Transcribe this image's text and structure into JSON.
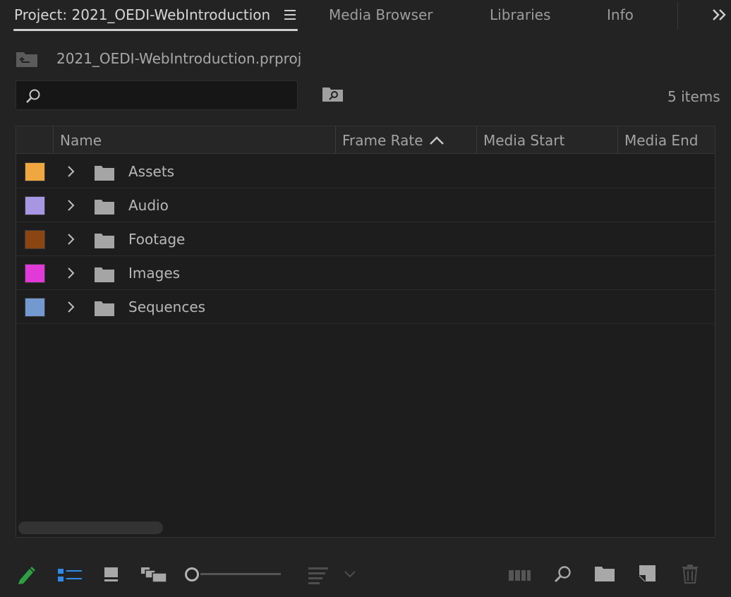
{
  "tabs": [
    {
      "label": "Project: 2021_OEDI-WebIntroduction",
      "active": true
    },
    {
      "label": "Media Browser",
      "active": false
    },
    {
      "label": "Libraries",
      "active": false
    },
    {
      "label": "Info",
      "active": false
    }
  ],
  "project": {
    "filename": "2021_OEDI-WebIntroduction.prproj",
    "item_count": "5 items"
  },
  "search": {
    "value": "",
    "placeholder": ""
  },
  "columns": [
    "Name",
    "Frame Rate",
    "Media Start",
    "Media End"
  ],
  "sort": {
    "column": "Frame Rate",
    "direction": "ascending"
  },
  "bins": [
    {
      "name": "Assets",
      "label_color": "#f0a73f"
    },
    {
      "name": "Audio",
      "label_color": "#a797e3"
    },
    {
      "name": "Footage",
      "label_color": "#8b4513"
    },
    {
      "name": "Images",
      "label_color": "#e23ad9"
    },
    {
      "name": "Sequences",
      "label_color": "#7399d1"
    }
  ],
  "toolbar": {
    "icons": [
      "pencil-icon",
      "list-view-icon",
      "icon-view-icon",
      "freeform-view-icon",
      "zoom-slider",
      "sort-icons-icon",
      "automate-to-sequence-icon",
      "find-icon",
      "new-bin-icon",
      "new-item-icon",
      "clear-icon"
    ]
  },
  "colors": {
    "background": "#232323",
    "panel": "#1d1d1d",
    "accent_blue": "#2d8ceb",
    "accent_green": "#2ea043"
  }
}
